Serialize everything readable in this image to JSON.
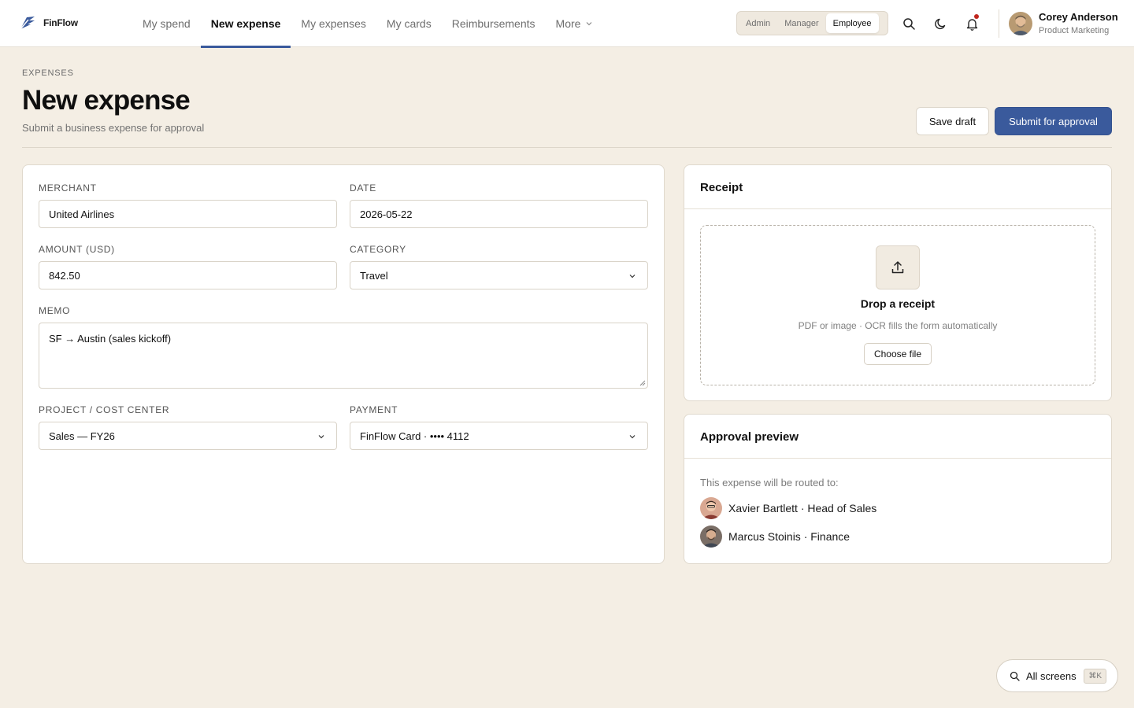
{
  "app": {
    "name": "FinFlow"
  },
  "nav": {
    "items": [
      {
        "label": "My spend",
        "active": false
      },
      {
        "label": "New expense",
        "active": true
      },
      {
        "label": "My expenses",
        "active": false
      },
      {
        "label": "My cards",
        "active": false
      },
      {
        "label": "Reimbursements",
        "active": false
      },
      {
        "label": "More",
        "active": false
      }
    ]
  },
  "roles": {
    "items": [
      "Admin",
      "Manager",
      "Employee"
    ],
    "selected": "Employee"
  },
  "user": {
    "name": "Corey Anderson",
    "role": "Product Marketing"
  },
  "header": {
    "eyebrow": "EXPENSES",
    "title": "New expense",
    "subtitle": "Submit a business expense for approval",
    "save_label": "Save draft",
    "submit_label": "Submit for approval"
  },
  "form": {
    "merchant": {
      "label": "MERCHANT",
      "value": "United Airlines"
    },
    "date": {
      "label": "DATE",
      "value": "2026-05-22"
    },
    "amount": {
      "label": "AMOUNT (USD)",
      "value": "842.50"
    },
    "category": {
      "label": "CATEGORY",
      "value": "Travel"
    },
    "memo": {
      "label": "MEMO",
      "value": "SF → Austin (sales kickoff)"
    },
    "project": {
      "label": "PROJECT / COST CENTER",
      "value": "Sales — FY26"
    },
    "payment": {
      "label": "PAYMENT",
      "value": "FinFlow Card · •••• 4112"
    }
  },
  "receipt": {
    "title": "Receipt",
    "drop_title": "Drop a receipt",
    "drop_sub": "PDF or image · OCR fills the form automatically",
    "choose_label": "Choose file"
  },
  "approval": {
    "title": "Approval preview",
    "route_text": "This expense will be routed to:",
    "approvers": [
      {
        "name": "Xavier Bartlett · Head of Sales"
      },
      {
        "name": "Marcus Stoinis · Finance"
      }
    ]
  },
  "floating": {
    "label": "All screens",
    "shortcut": "⌘K"
  },
  "colors": {
    "accent": "#3a5a9c",
    "background": "#f4eee4",
    "notification": "#c0261e"
  }
}
